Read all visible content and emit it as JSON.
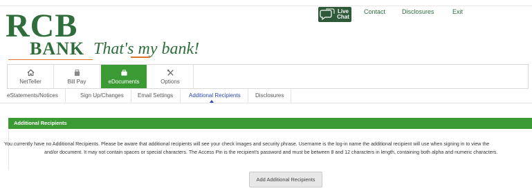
{
  "brand": {
    "name_top": "RCB",
    "name_bottom": "BANK",
    "tagline": "That's my bank!"
  },
  "header_links": {
    "live_chat_line1": "Live",
    "live_chat_line2": "Chat",
    "contact": "Contact",
    "disclosures": "Disclosures",
    "exit": "Exit"
  },
  "nav": {
    "items": [
      {
        "label": "NetTeller",
        "icon": "home-icon"
      },
      {
        "label": "Bill Pay",
        "icon": "bill-icon"
      },
      {
        "label": "eDocuments",
        "icon": "briefcase-icon",
        "active": true
      },
      {
        "label": "Options",
        "icon": "tools-icon"
      }
    ]
  },
  "subtabs": {
    "items": [
      {
        "label": "eStatements/Notices"
      },
      {
        "label": "Sign Up/Changes"
      },
      {
        "label": "Email Settings"
      },
      {
        "label": "Additional Recipients",
        "active": true
      },
      {
        "label": "Disclosures"
      }
    ]
  },
  "panel": {
    "title": "Additional Recipients",
    "message_line1": "You currently have no Additional Recipients. Please be aware that additional recipients will see your check images and security phrase. Username is the log-in name the additional recipient will use when signing in to view the",
    "message_line2": "and/or document. It may not contain spaces or special characters. The Access Pin is the recipient's password and must be between 8 and 12 characters in length, containing both alpha and numeric characters.",
    "button_label": "Add Additional Recipients"
  },
  "colors": {
    "brand_green": "#2f6e3c",
    "active_green": "#3c9a35",
    "accent_orange": "#d9762b",
    "active_tab_blue": "#2b43b8"
  }
}
